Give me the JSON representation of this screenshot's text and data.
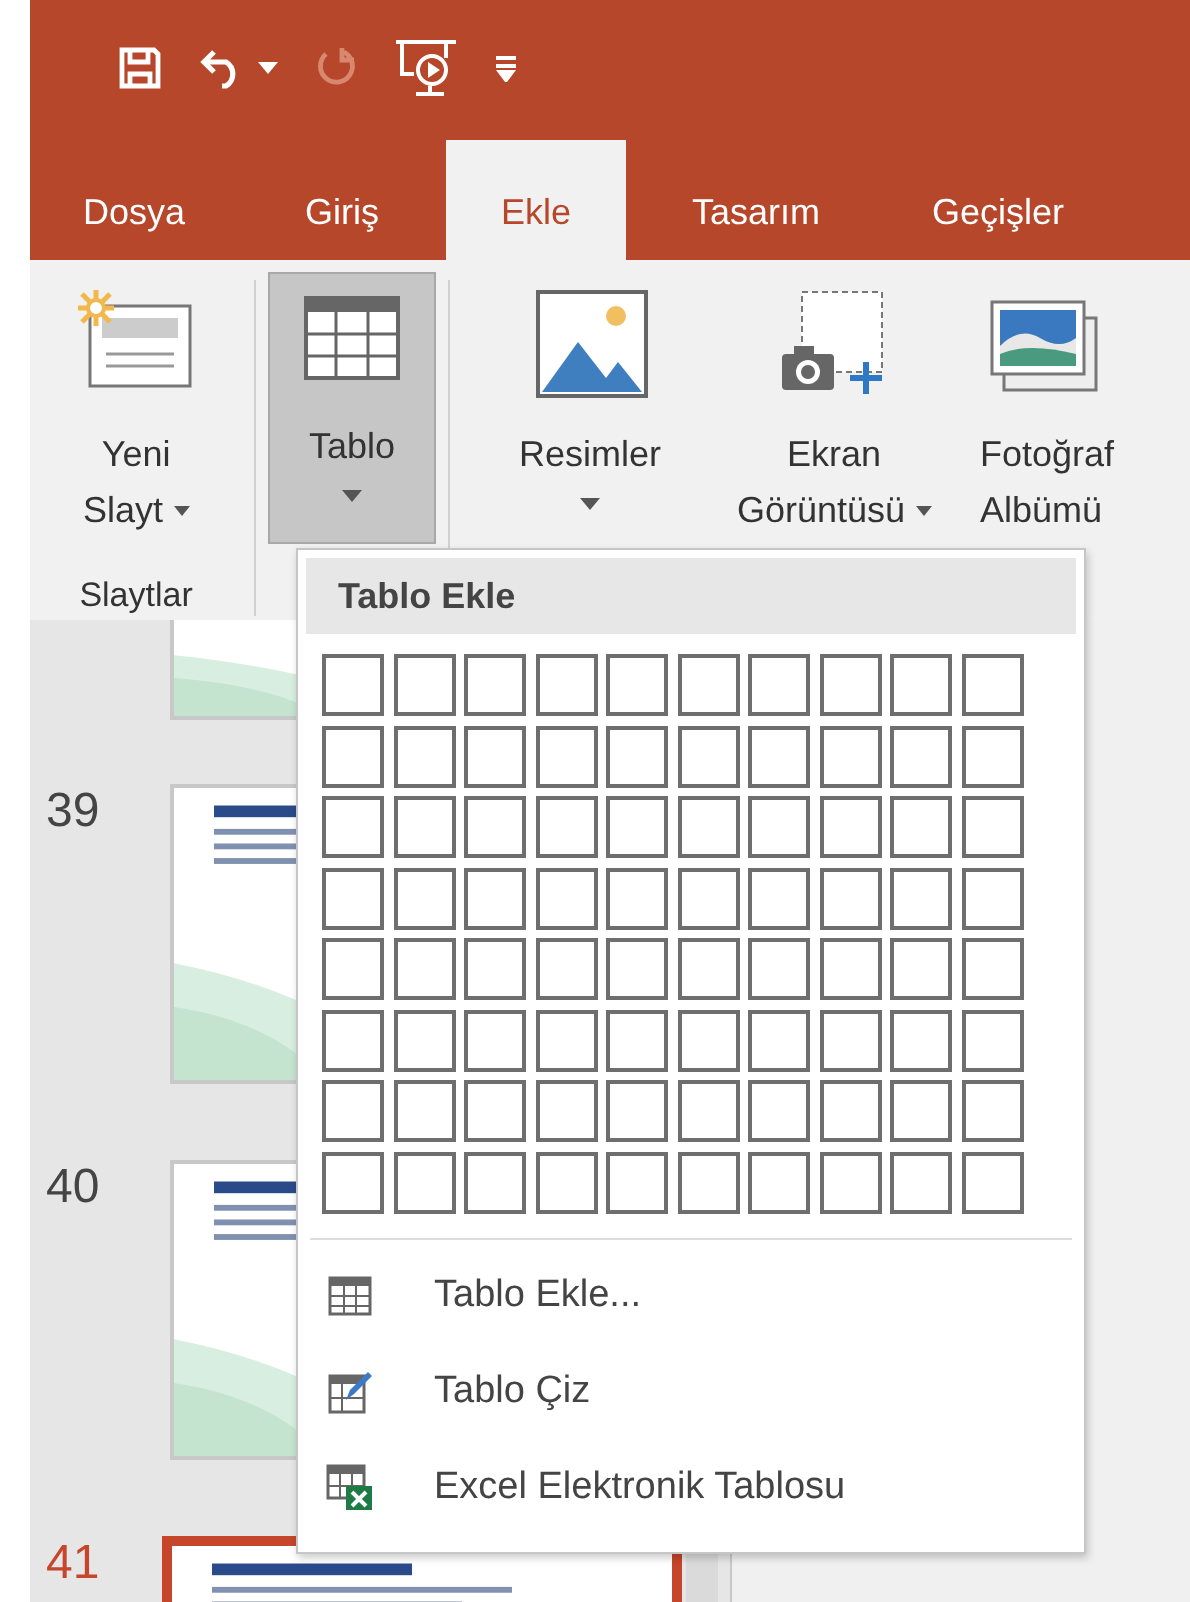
{
  "quick_access": [
    {
      "kind": "save",
      "disabled": false
    },
    {
      "kind": "undo",
      "disabled": false
    },
    {
      "kind": "caret",
      "disabled": false
    },
    {
      "kind": "redo",
      "disabled": true
    },
    {
      "kind": "slideshow",
      "disabled": false
    },
    {
      "kind": "customize",
      "disabled": false
    }
  ],
  "tabs": [
    {
      "label": "Dosya",
      "selected": false
    },
    {
      "label": "Giriş",
      "selected": false
    },
    {
      "label": "Ekle",
      "selected": true
    },
    {
      "label": "Tasarım",
      "selected": false
    },
    {
      "label": "Geçişler",
      "selected": false
    }
  ],
  "ribbon": {
    "buttons": [
      {
        "kind": "new-slide",
        "lines": [
          "Yeni",
          "Slayt"
        ],
        "dropdown": true,
        "selected": false
      },
      {
        "kind": "table",
        "lines": [
          "Tablo"
        ],
        "dropdown": true,
        "selected": true
      },
      {
        "kind": "pictures",
        "lines": [
          "Resimler"
        ],
        "dropdown": true,
        "selected": false
      },
      {
        "kind": "screenshot",
        "lines": [
          "Ekran",
          "Görüntüsü"
        ],
        "dropdown": true,
        "selected": false
      },
      {
        "kind": "album",
        "lines": [
          "Fotoğraf",
          "Albümü"
        ],
        "dropdown": false,
        "selected": false
      }
    ],
    "group_label": "Slaytlar"
  },
  "slides": [
    {
      "selected": false
    },
    {
      "number": "39",
      "selected": false
    },
    {
      "number": "40",
      "selected": false
    },
    {
      "number": "41",
      "selected": true
    }
  ],
  "menu": {
    "title": "Tablo Ekle",
    "grid": [
      [
        {
          "selected": false
        },
        {
          "selected": false
        },
        {
          "selected": false
        },
        {
          "selected": false
        },
        {
          "selected": false
        },
        {
          "selected": false
        },
        {
          "selected": false
        },
        {
          "selected": false
        },
        {
          "selected": false
        },
        {
          "selected": false
        }
      ],
      [
        {
          "selected": false
        },
        {
          "selected": false
        },
        {
          "selected": false
        },
        {
          "selected": false
        },
        {
          "selected": false
        },
        {
          "selected": false
        },
        {
          "selected": false
        },
        {
          "selected": false
        },
        {
          "selected": false
        },
        {
          "selected": false
        }
      ],
      [
        {
          "selected": false
        },
        {
          "selected": false
        },
        {
          "selected": false
        },
        {
          "selected": false
        },
        {
          "selected": false
        },
        {
          "selected": false
        },
        {
          "selected": false
        },
        {
          "selected": false
        },
        {
          "selected": false
        },
        {
          "selected": false
        }
      ],
      [
        {
          "selected": false
        },
        {
          "selected": false
        },
        {
          "selected": false
        },
        {
          "selected": false
        },
        {
          "selected": false
        },
        {
          "selected": false
        },
        {
          "selected": false
        },
        {
          "selected": false
        },
        {
          "selected": false
        },
        {
          "selected": false
        }
      ],
      [
        {
          "selected": false
        },
        {
          "selected": false
        },
        {
          "selected": false
        },
        {
          "selected": false
        },
        {
          "selected": false
        },
        {
          "selected": false
        },
        {
          "selected": false
        },
        {
          "selected": false
        },
        {
          "selected": false
        },
        {
          "selected": false
        }
      ],
      [
        {
          "selected": false
        },
        {
          "selected": false
        },
        {
          "selected": false
        },
        {
          "selected": false
        },
        {
          "selected": false
        },
        {
          "selected": false
        },
        {
          "selected": false
        },
        {
          "selected": false
        },
        {
          "selected": false
        },
        {
          "selected": false
        }
      ],
      [
        {
          "selected": false
        },
        {
          "selected": false
        },
        {
          "selected": false
        },
        {
          "selected": false
        },
        {
          "selected": false
        },
        {
          "selected": false
        },
        {
          "selected": false
        },
        {
          "selected": false
        },
        {
          "selected": false
        },
        {
          "selected": false
        }
      ],
      [
        {
          "selected": false
        },
        {
          "selected": false
        },
        {
          "selected": false
        },
        {
          "selected": false
        },
        {
          "selected": false
        },
        {
          "selected": false
        },
        {
          "selected": false
        },
        {
          "selected": false
        },
        {
          "selected": false
        },
        {
          "selected": false
        }
      ]
    ],
    "items": [
      {
        "kind": "insert",
        "label": "Tablo Ekle..."
      },
      {
        "kind": "draw",
        "label": "Tablo Çiz"
      },
      {
        "kind": "excel",
        "label": "Excel Elektronik Tablosu"
      }
    ]
  }
}
